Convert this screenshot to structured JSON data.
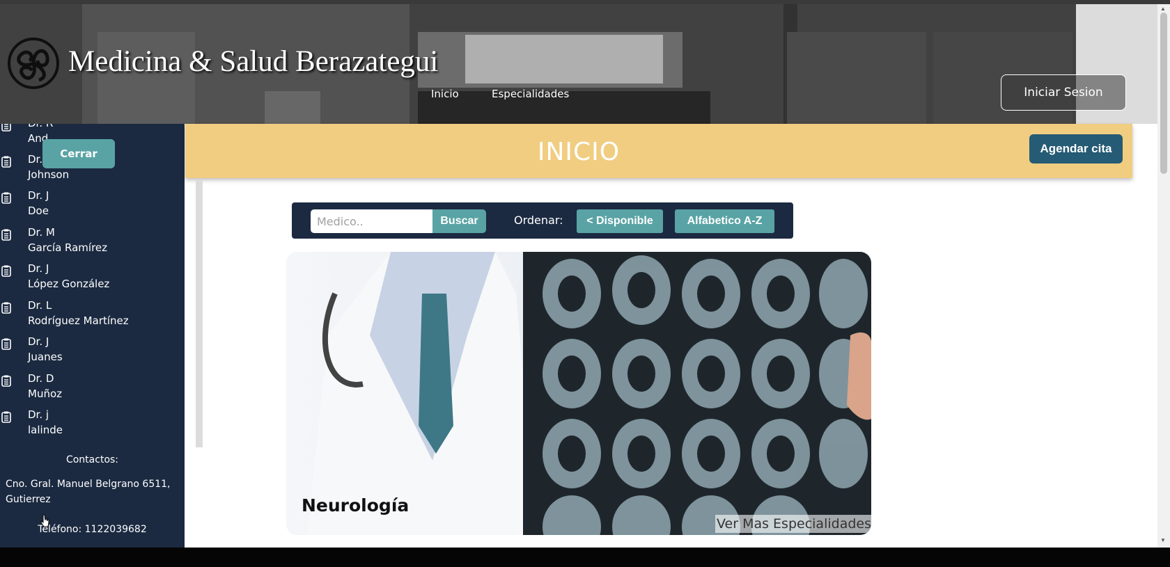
{
  "header": {
    "site_title": "Medicina & Salud Berazategui",
    "nav": [
      "Inicio",
      "Especialidades"
    ],
    "login_label": "Iniciar Sesion"
  },
  "sidebar": {
    "close_label": "Cerrar",
    "doctors": [
      {
        "line1": "Dr. R",
        "line2": "And"
      },
      {
        "line1": "Dr.",
        "line2": "Johnson"
      },
      {
        "line1": "Dr. J",
        "line2": "Doe"
      },
      {
        "line1": "Dr. M",
        "line2": "García Ramírez"
      },
      {
        "line1": "Dr. J",
        "line2": "López González"
      },
      {
        "line1": "Dr. L",
        "line2": "Rodríguez Martínez"
      },
      {
        "line1": "Dr. J",
        "line2": "Juanes"
      },
      {
        "line1": "Dr. D",
        "line2": "Muñoz"
      },
      {
        "line1": "Dr. j",
        "line2": "lalinde"
      }
    ],
    "contacts_heading": "Contactos:",
    "address": "Cno. Gral. Manuel Belgrano 6511, Gutierrez",
    "phone": "Teléfono: 1122039682"
  },
  "main": {
    "banner_title": "INICIO",
    "appointment_label": "Agendar cita",
    "search": {
      "placeholder": "Medico..",
      "value": "",
      "button_label": "Buscar",
      "sort_label": "Ordenar:",
      "sort_available_label": "< Disponible",
      "sort_alpha_label": "Alfabetico A-Z"
    },
    "card": {
      "title": "Neurología",
      "more_label": "Ver Mas Especialidades"
    }
  },
  "colors": {
    "sidebar_bg": "#1b2a41",
    "banner_bg": "#f0cd81",
    "accent_teal": "#5aa3a5",
    "appointment_btn": "#255b74"
  }
}
